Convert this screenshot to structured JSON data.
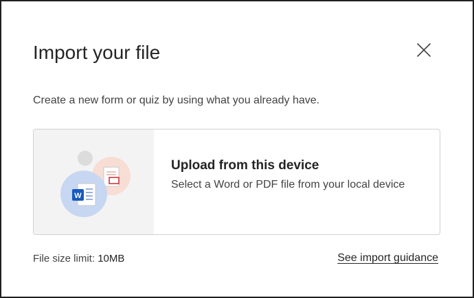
{
  "dialog": {
    "title": "Import your file",
    "subtitle": "Create a new form or quiz by using what you already have."
  },
  "upload_option": {
    "heading": "Upload from this device",
    "description": "Select a Word or PDF file from your local device",
    "word_icon_letter": "W",
    "colors": {
      "word_blue": "#185abd",
      "pdf_red": "#d13438",
      "art_background": "#f3f3f3"
    }
  },
  "footer": {
    "file_size_label": "File size limit:",
    "file_size_value": "10MB",
    "guidance_link": "See import guidance"
  },
  "icons": {
    "close": "close-icon",
    "upload_art": "word-pdf-illustration-icon"
  }
}
